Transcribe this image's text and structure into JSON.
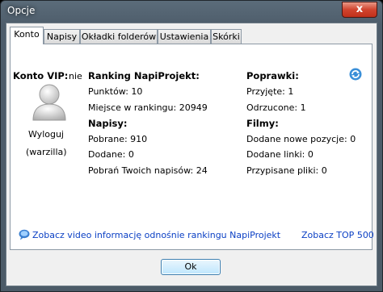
{
  "window": {
    "title": "Opcje",
    "close_glyph": "x"
  },
  "tabs": [
    {
      "label": "Konto",
      "active": true
    },
    {
      "label": "Napisy"
    },
    {
      "label": "Okładki folderów"
    },
    {
      "label": "Ustawienia"
    },
    {
      "label": "Skórki"
    }
  ],
  "account": {
    "vip_label": "Konto VIP:",
    "vip_value": "nie",
    "logout_label": "Wyloguj",
    "username": "(warzilla)"
  },
  "ranking": {
    "heading": "Ranking NapiProjekt:",
    "points": "Punktów:  10",
    "rank": "Miejsce w rankingu:  20949"
  },
  "subtitles": {
    "heading": "Napisy:",
    "downloaded": "Pobrane:  910",
    "added": "Dodane: 0",
    "your_downloads": "Pobrań Twoich napisów:  24"
  },
  "corrections": {
    "heading": "Poprawki:",
    "accepted": "Przyjęte:  1",
    "rejected": "Odrzucone:  1"
  },
  "movies": {
    "heading": "Filmy:",
    "new_items": "Dodane nowe pozycje:  0",
    "added_links": "Dodane linki:  0",
    "assigned_files": "Przypisane pliki: 0"
  },
  "links": {
    "video_info": "Zobacz video informację odnośnie rankingu NapiProjekt",
    "top500": "Zobacz TOP 500"
  },
  "buttons": {
    "ok": "Ok"
  },
  "icons": {
    "avatar": "user-avatar-icon",
    "refresh": "refresh-icon",
    "chat": "speech-bubble-icon"
  },
  "colors": {
    "link": "#0a3fc4",
    "close": "#c1301b"
  }
}
